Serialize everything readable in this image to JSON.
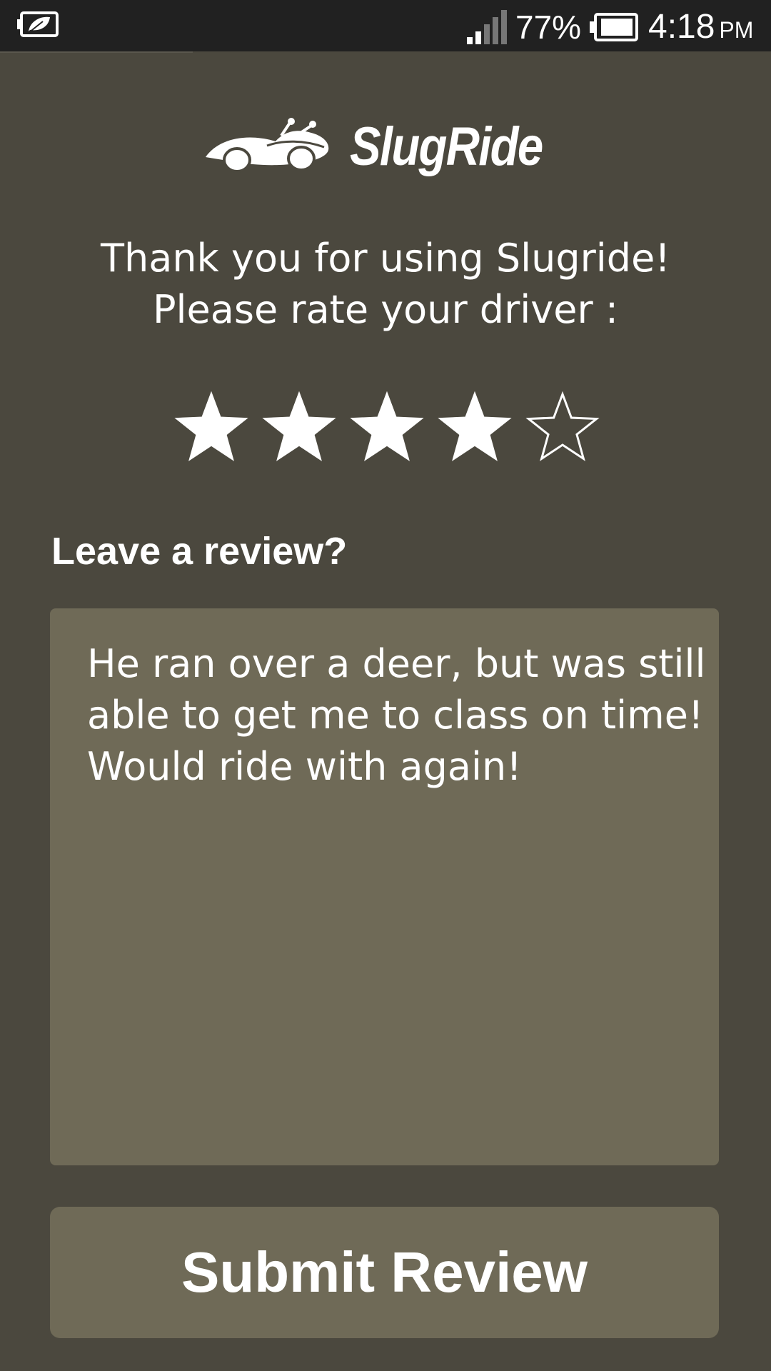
{
  "status_bar": {
    "left_icon": "leaf-battery-saver-icon",
    "signal_icon": "cell-signal-icon",
    "battery_percent": "77%",
    "battery_icon": "battery-icon",
    "time": "4:18",
    "ampm": "PM"
  },
  "header": {
    "logo_icon": "slug-car-logo-icon",
    "app_name": "SlugRide"
  },
  "prompt": {
    "line1": "Thank you for using Slugride!",
    "line2": "Please rate your driver :"
  },
  "rating": {
    "value": 4,
    "max": 5,
    "icon": "star-icon"
  },
  "review": {
    "label": "Leave a review?",
    "text": "He ran over a deer, but was still\nable to get me to class on time!\nWould ride with again!"
  },
  "submit": {
    "label": "Submit Review"
  },
  "colors": {
    "background": "#4b483e",
    "status_bar": "#212121",
    "field": "#6f6a57",
    "text": "#ffffff"
  }
}
